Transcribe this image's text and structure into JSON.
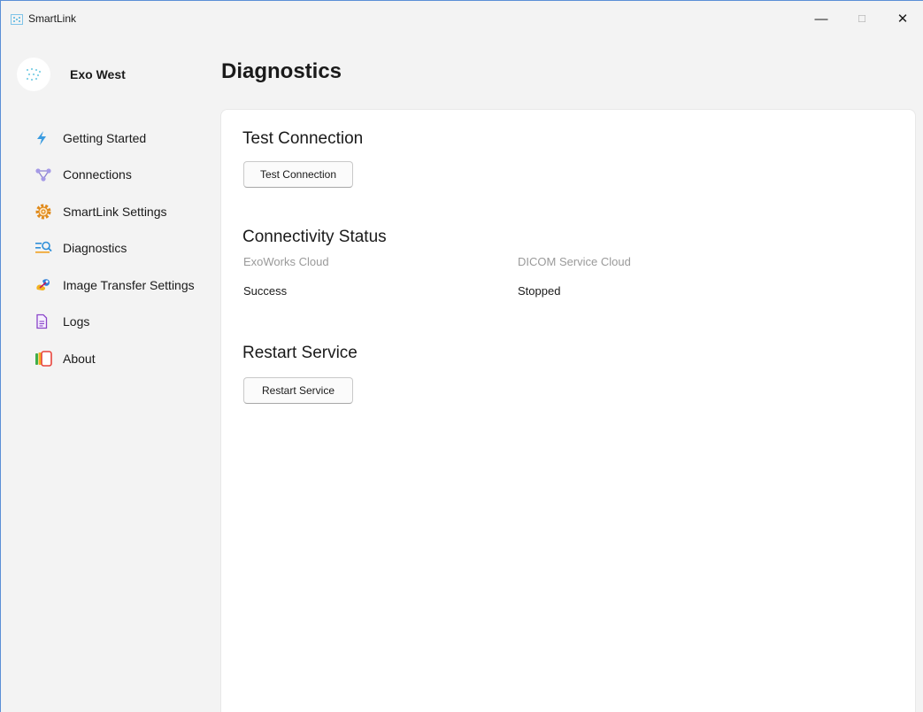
{
  "window": {
    "title": "SmartLink",
    "controls": {
      "minimize": "—",
      "maximize": "☐",
      "close": "✕"
    }
  },
  "profile": {
    "name": "Exo West"
  },
  "sidebar": {
    "items": [
      {
        "label": "Getting Started",
        "icon": "lightning-icon"
      },
      {
        "label": "Connections",
        "icon": "network-icon"
      },
      {
        "label": "SmartLink Settings",
        "icon": "gear-icon"
      },
      {
        "label": "Diagnostics",
        "icon": "diagnostics-icon"
      },
      {
        "label": "Image Transfer Settings",
        "icon": "image-transfer-icon"
      },
      {
        "label": "Logs",
        "icon": "document-icon"
      },
      {
        "label": "About",
        "icon": "about-icon"
      }
    ]
  },
  "main": {
    "title": "Diagnostics",
    "test_connection": {
      "heading": "Test Connection",
      "button": "Test Connection"
    },
    "connectivity": {
      "heading": "Connectivity Status",
      "items": [
        {
          "label": "ExoWorks Cloud",
          "value": "Success"
        },
        {
          "label": "DICOM Service Cloud",
          "value": "Stopped"
        }
      ]
    },
    "restart": {
      "heading": "Restart Service",
      "button": "Restart Service"
    }
  },
  "colors": {
    "accent": "#2f8fd8",
    "window_border": "#5b8fd6",
    "sidebar_bg": "#f3f3f3",
    "card_bg": "#ffffff"
  }
}
